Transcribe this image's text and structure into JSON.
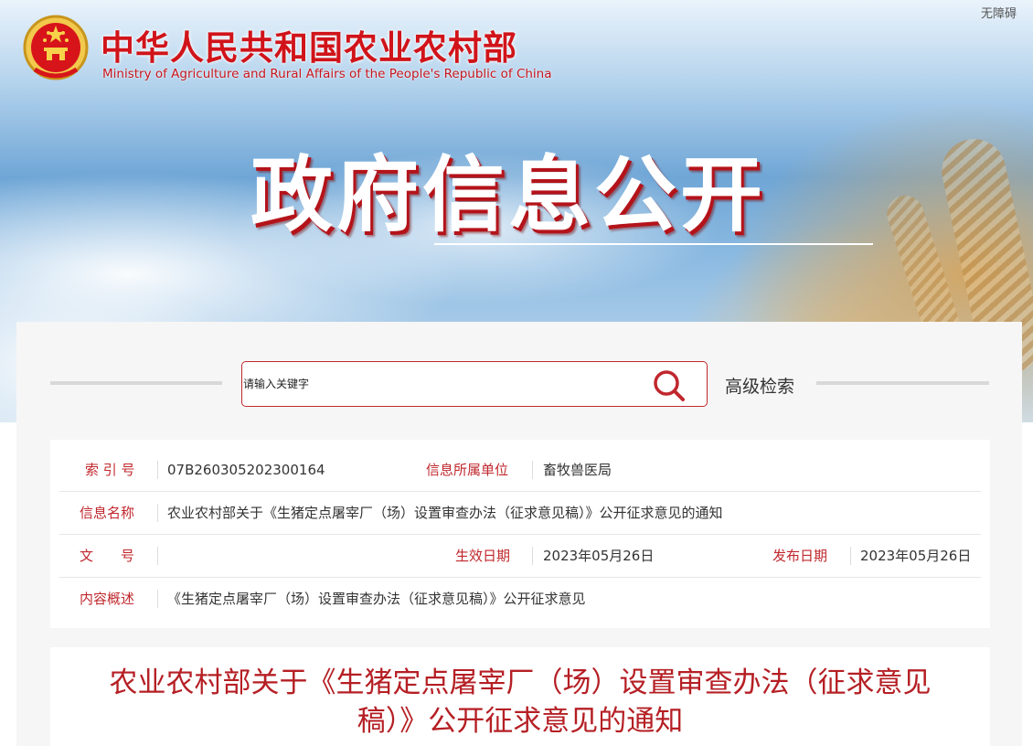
{
  "header": {
    "accessibility_label": "无障碍",
    "ministry_name_cn": "中华人民共和国农业农村部",
    "ministry_name_en": "Ministry of Agriculture and Rural Affairs of the People's Republic of China",
    "banner_title": "政府信息公开",
    "icon": "national-emblem-icon"
  },
  "search": {
    "placeholder": "请输入关键字",
    "value": "",
    "icon": "search-icon",
    "advanced_label": "高级检索"
  },
  "info": {
    "index_label": "索 引 号",
    "index_value": "07B260305202300164",
    "unit_label": "信息所属单位",
    "unit_value": "畜牧兽医局",
    "name_label": "信息名称",
    "name_value": "农业农村部关于《生猪定点屠宰厂（场）设置审查办法（征求意见稿）》公开征求意见的通知",
    "doc_label": "文　　号",
    "doc_value": "",
    "effective_label": "生效日期",
    "effective_value": "2023年05月26日",
    "publish_label": "发布日期",
    "publish_value": "2023年05月26日",
    "summary_label": "内容概述",
    "summary_value": "《生猪定点屠宰厂（场）设置审查办法（征求意见稿）》公开征求意见"
  },
  "article": {
    "title": "农业农村部关于《生猪定点屠宰厂（场）设置审查办法（征求意见稿）》公开征求意见的通知"
  },
  "colors": {
    "brand_red": "#c0272d",
    "title_red": "#b51f24"
  }
}
